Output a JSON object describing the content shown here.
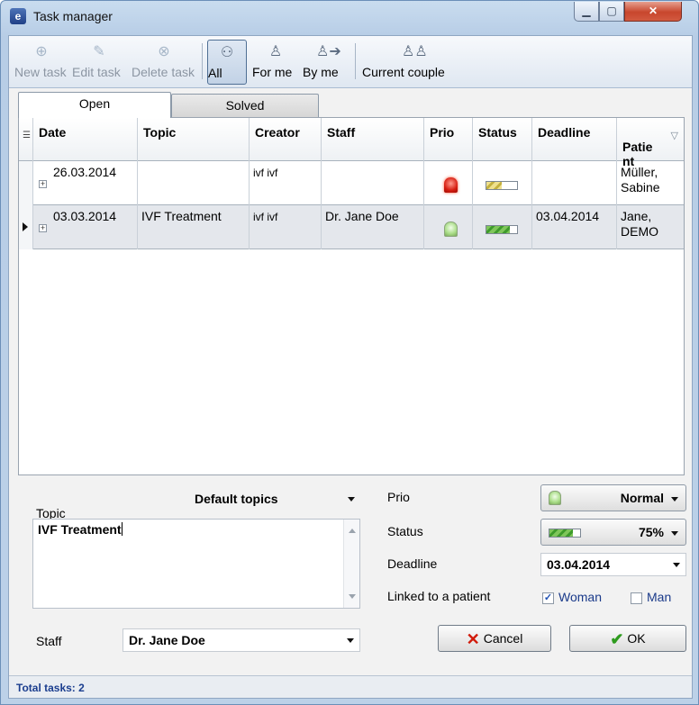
{
  "window": {
    "title": "Task manager",
    "icon": "app-logo-icon"
  },
  "toolbar": {
    "new_task": "New task",
    "edit_task": "Edit task",
    "delete_task": "Delete task",
    "all": "All",
    "for_me": "For me",
    "by_me": "By me",
    "current_couple": "Current couple"
  },
  "tabs": {
    "open": "Open",
    "solved": "Solved"
  },
  "grid": {
    "columns": [
      "Date",
      "Topic",
      "Creator",
      "Staff",
      "Prio",
      "Status",
      "Deadline",
      "Patie\nnt"
    ],
    "rows": [
      {
        "date": "26.03.2014",
        "topic": "",
        "creator": "ivf ivf",
        "staff": "",
        "prio": "high",
        "status_percent": 50,
        "deadline": "",
        "patient": "Müller, Sabine"
      },
      {
        "date": "03.03.2014",
        "topic": "IVF Treatment",
        "creator": "ivf ivf",
        "staff": "Dr. Jane Doe",
        "prio": "normal",
        "status_percent": 75,
        "deadline": "03.04.2014",
        "patient": "Jane, DEMO"
      }
    ]
  },
  "form": {
    "topic_label": "Topic",
    "topic_category": "Default topics",
    "topic_text": "IVF Treatment",
    "staff_label": "Staff",
    "staff_value": "Dr. Jane Doe",
    "prio_label": "Prio",
    "prio_value": "Normal",
    "status_label": "Status",
    "status_value": "75%",
    "deadline_label": "Deadline",
    "deadline_value": "03.04.2014",
    "linked_label": "Linked to a patient",
    "woman_label": "Woman",
    "woman_checked": true,
    "man_label": "Man",
    "man_checked": false,
    "cancel": "Cancel",
    "ok": "OK"
  },
  "statusbar": {
    "total": "Total tasks: 2"
  },
  "colors": {
    "accent": "#1b3e8f",
    "prio_high": "#d61c10",
    "prio_normal": "#a9dd87"
  }
}
